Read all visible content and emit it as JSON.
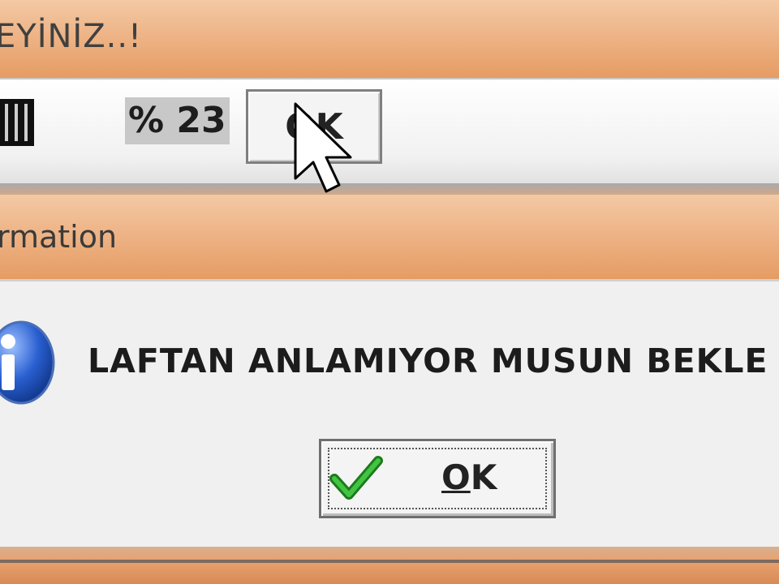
{
  "back_window": {
    "title": "EYİNİZ..!",
    "percent": "% 23",
    "ok_label": "OK"
  },
  "front_dialog": {
    "title": "rmation",
    "message": "LAFTAN ANLAMIYOR MUSUN BEKLE D",
    "ok_accesskey": "O",
    "ok_rest": "K"
  },
  "icons": {
    "info": "info-icon",
    "check": "checkmark-icon",
    "cursor": "mouse-cursor-icon"
  },
  "colors": {
    "titlebar": "#eeb487",
    "dialog_bg": "#f0f0f0",
    "info_blue": "#2a5fd0",
    "check_green": "#2aa52a"
  }
}
